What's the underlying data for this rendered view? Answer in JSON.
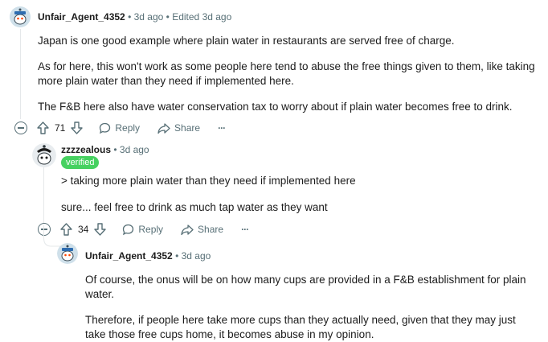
{
  "comments": [
    {
      "username": "Unfair_Agent_4352",
      "time": "3d ago",
      "edited": "Edited 3d ago",
      "paragraphs": [
        "Japan is one good example where plain water in restaurants are served free of charge.",
        "As for here, this won't work as some people here tend to abuse the free things given to them, like taking more plain water than they need if implemented here.",
        "The F&B here also have water conservation tax to worry about if plain water becomes free to drink."
      ],
      "votes": "71",
      "reply_label": "Reply",
      "share_label": "Share",
      "more_label": "···"
    },
    {
      "username": "zzzzealous",
      "time": "3d ago",
      "flair": "verified",
      "paragraphs": [
        "> taking more plain water than they need if implemented here",
        "sure... feel free to drink as much tap water as they want"
      ],
      "votes": "34",
      "reply_label": "Reply",
      "share_label": "Share",
      "more_label": "···"
    },
    {
      "username": "Unfair_Agent_4352",
      "time": "3d ago",
      "paragraphs": [
        "Of course, the onus will be on how many cups are provided in a F&B establishment for plain water.",
        "Therefore, if people here take more cups than they actually need, given that they may just take those free cups home, it becomes abuse in my opinion."
      ]
    }
  ],
  "separator": "•",
  "colors": {
    "meta": "#576f76",
    "flair_bg": "#46d160",
    "thread": "#e5e8ea"
  }
}
